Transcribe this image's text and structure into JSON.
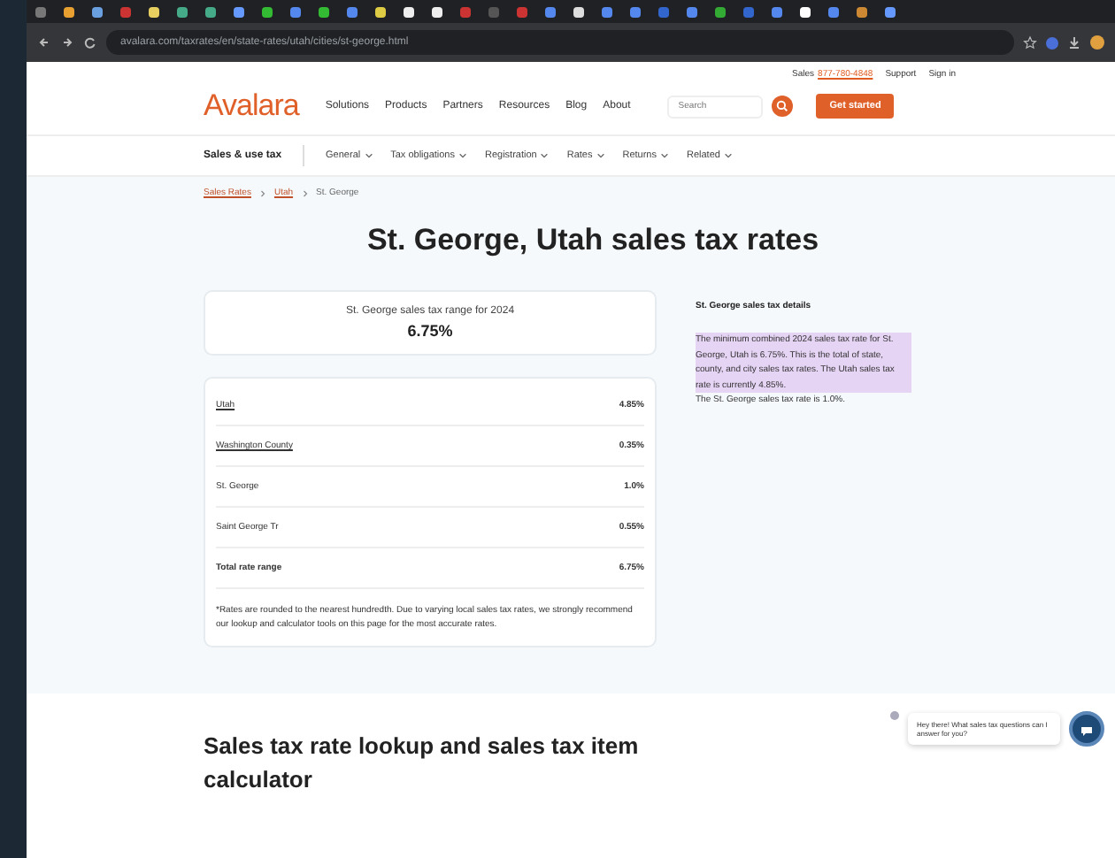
{
  "browser": {
    "url": "avalara.com/taxrates/en/state-rates/utah/cities/st-george.html"
  },
  "topbar": {
    "sales_label": "Sales",
    "sales_phone": "877-780-4848",
    "links": [
      "Support",
      "Sign in"
    ]
  },
  "nav": {
    "logo": "Avalara",
    "items": [
      "Solutions",
      "Products",
      "Partners",
      "Resources",
      "Blog",
      "About"
    ],
    "search": {
      "placeholder": "Search"
    },
    "cta": "Get started"
  },
  "subnav": {
    "title": "Sales & use tax",
    "items": [
      "General",
      "Tax obligations",
      "Registration",
      "Rates",
      "Returns",
      "Related"
    ]
  },
  "breadcrumb": [
    "Sales Rates",
    "Utah",
    "St. George"
  ],
  "title": "St. George, Utah sales tax rates",
  "summary": {
    "label": "St. George sales tax range for 2024",
    "value": "6.75%"
  },
  "rates": [
    {
      "name": "Utah",
      "value": "4.85%",
      "kind": "link"
    },
    {
      "name": "Washington County",
      "value": "0.35%",
      "kind": "link"
    },
    {
      "name": "St. George",
      "value": "1.0%",
      "kind": "plain"
    },
    {
      "name": "Saint George Tr",
      "value": "0.55%",
      "kind": "plain"
    },
    {
      "name": "Total rate range",
      "value": "6.75%",
      "kind": "total"
    }
  ],
  "footnote": "*Rates are rounded to the nearest hundredth. Due to varying local sales tax rates, we strongly recommend our lookup and calculator tools on this page for the most accurate rates.",
  "details": {
    "heading": "St. George sales tax details",
    "highlighted": "The minimum combined 2024 sales tax rate for St. George, Utah is 6.75%. This is the total of state, county, and city sales tax rates. The Utah sales tax rate is currently 4.85%.",
    "rest": "The St. George sales tax rate is 1.0%."
  },
  "section_title": "Sales tax rate lookup and sales tax item calculator",
  "chat": {
    "message": "Hey there! What sales tax questions can I answer for you?"
  }
}
